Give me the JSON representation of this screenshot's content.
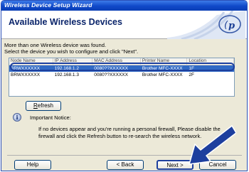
{
  "window": {
    "title": "Wireless Device Setup Wizard"
  },
  "header": {
    "title": "Available Wireless Devices"
  },
  "instructions": {
    "line1": "More than one Wireless device was found.",
    "line2": "Select the device you wish to configure and click \"Next\"."
  },
  "device_list": {
    "columns": [
      "Node Name",
      "IP Address",
      "MAC Address",
      "Printer Name",
      "Location"
    ],
    "rows": [
      {
        "node": "BRWXXXXXX",
        "ip": "192.168.1.2",
        "mac": "0080??XXXXXX",
        "printer": "Brother MFC-XXXX",
        "location": "1F",
        "selected": true
      },
      {
        "node": "BRWXXXXXX",
        "ip": "192.168.1.3",
        "mac": "0080??XXXXXX",
        "printer": "Brother MFC-XXXX",
        "location": "2F",
        "selected": false
      }
    ]
  },
  "refresh_button": {
    "prefix": "",
    "accel": "R",
    "rest": "efresh"
  },
  "notice": {
    "title": "Important Notice:",
    "body": "If no devices appear and you're running a personal firewall, Please disable the firewall and click the Refresh button to re-search the wireless network."
  },
  "footer": {
    "help_label": "Help",
    "back_label": "< Back",
    "next_label": "Next >",
    "cancel_label": "Cancel"
  },
  "colors": {
    "selection": "#316ac5",
    "title_bar": "#0f48c8",
    "header_title": "#0a246a",
    "callout_arrow": "#1d3f9e"
  },
  "icons": [
    "info-icon",
    "callout-arrow-icon",
    "brother-wireless-logo-icon"
  ]
}
